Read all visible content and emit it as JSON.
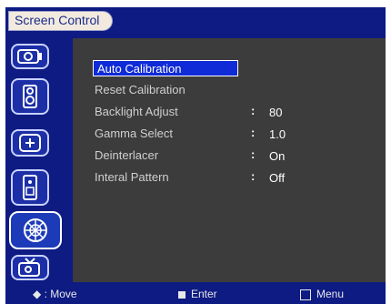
{
  "window": {
    "title": "Screen Control"
  },
  "sidebar": {
    "items": [
      {
        "icon": "display-icon"
      },
      {
        "icon": "speaker-icon"
      },
      {
        "icon": "crosshair-icon"
      },
      {
        "icon": "remote-icon"
      },
      {
        "icon": "mesh-globe-icon",
        "active": true
      },
      {
        "icon": "tv-icon"
      }
    ]
  },
  "menu": {
    "rows": [
      {
        "label": "Auto Calibration",
        "selected": true,
        "type": "action"
      },
      {
        "label": "Reset Calibration",
        "selected": false,
        "type": "action"
      },
      {
        "label": "Backlight Adjust",
        "selected": false,
        "value": "80"
      },
      {
        "label": "Gamma Select",
        "selected": false,
        "value": "1.0"
      },
      {
        "label": "Deinterlacer",
        "selected": false,
        "value": "On"
      },
      {
        "label": "Interal Pattern",
        "selected": false,
        "value": "Off"
      }
    ]
  },
  "footer": {
    "move": "◆ : Move",
    "enter": "Enter",
    "menu": "Menu"
  },
  "colors": {
    "accent": "#0f2ad7",
    "panel": "#3c3c3c",
    "chrome": "#0d1b83",
    "text": "#cfcfcf"
  }
}
